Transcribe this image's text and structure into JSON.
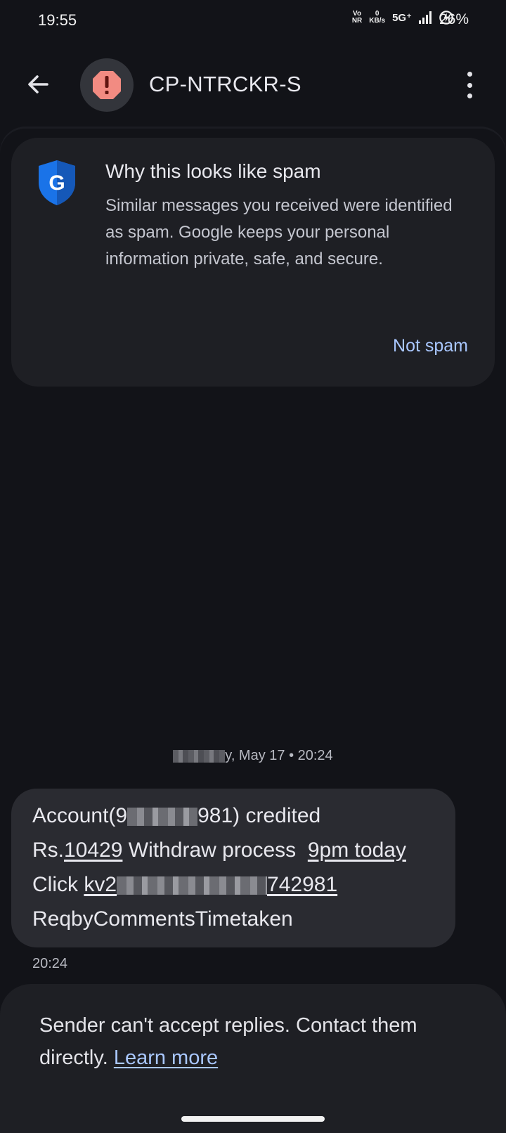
{
  "status_bar": {
    "time": "19:55",
    "volte_top": "Vo",
    "volte_bottom": "NR",
    "speed_value": "0",
    "speed_unit": "KB/s",
    "network": "5G⁺",
    "battery": "26%"
  },
  "app_bar": {
    "contact_name": "CP-NTRCKR-S",
    "back_icon": "arrow-back-icon",
    "avatar_icon": "spam-warning-icon",
    "menu_icon": "more-vert-icon"
  },
  "spam_card": {
    "title": "Why this looks like spam",
    "body": "Similar messages you received were identified as spam. Google keeps your personal information private, safe, and secure.",
    "action": "Not spam",
    "icon": "google-shield-icon"
  },
  "conversation": {
    "date_suffix": "y, May 17 • 20:24",
    "message": {
      "line1_prefix": "Account(9",
      "line1_suffix": "981) credited",
      "line2_prefix": "Rs.",
      "line2_amount": "10429",
      "line2_middle": " Withdraw process  ",
      "line2_time": "9pm today",
      "line3_prefix": "Click ",
      "line3_link_start": "kv2",
      "line3_link_end": "742981",
      "line4": "ReqbyCommentsTimetaken"
    },
    "time": "20:24"
  },
  "footer": {
    "text": "Sender can't accept replies. Contact them directly. ",
    "link": "Learn more"
  },
  "colors": {
    "background": "#121318",
    "card": "#1e1f24",
    "bubble": "#2a2b31",
    "accent": "#a9c7ff",
    "warning": "#f28b82"
  }
}
